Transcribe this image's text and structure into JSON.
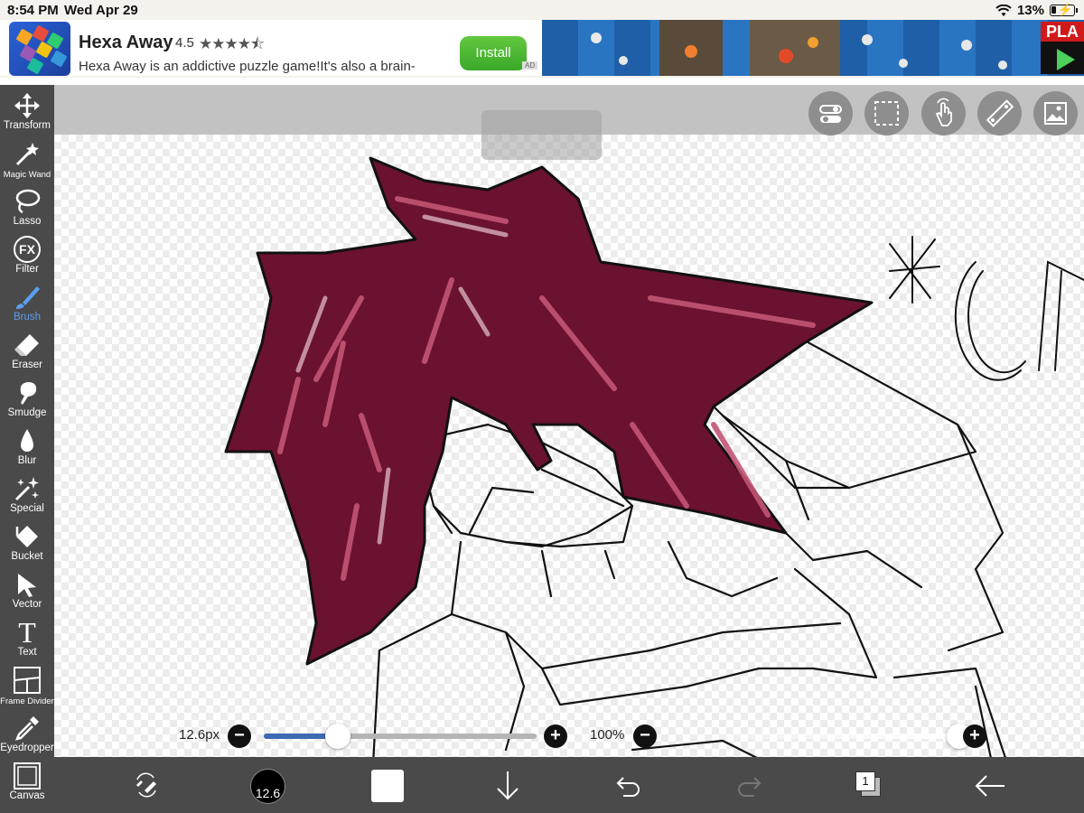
{
  "status_bar": {
    "time": "8:54 PM",
    "date": "Wed Apr 29",
    "battery": "13%"
  },
  "ad": {
    "title": "Hexa Away",
    "rating": "4.5",
    "stars": "★★★★⯪",
    "description": "Hexa Away is an addictive puzzle game!It's also a brain-",
    "install_label": "Install",
    "badge": "AD",
    "info": "i",
    "right_banner_text": "PLA"
  },
  "toolbar": {
    "items": [
      {
        "label": "Transform",
        "icon": "move-arrows-icon"
      },
      {
        "label": "Magic Wand",
        "icon": "magic-wand-icon"
      },
      {
        "label": "Lasso",
        "icon": "lasso-icon"
      },
      {
        "label": "Filter",
        "icon": "fx-icon",
        "glyph": "FX"
      },
      {
        "label": "Brush",
        "icon": "brush-icon",
        "active": true
      },
      {
        "label": "Eraser",
        "icon": "eraser-icon"
      },
      {
        "label": "Smudge",
        "icon": "smudge-icon"
      },
      {
        "label": "Blur",
        "icon": "blur-drop-icon"
      },
      {
        "label": "Special",
        "icon": "sparkle-wand-icon"
      },
      {
        "label": "Bucket",
        "icon": "bucket-icon"
      },
      {
        "label": "Vector",
        "icon": "vector-cursor-icon"
      },
      {
        "label": "Text",
        "icon": "text-icon",
        "glyph": "T"
      },
      {
        "label": "Frame Divider",
        "icon": "frame-divider-icon"
      },
      {
        "label": "Eyedropper",
        "icon": "eyedropper-icon"
      },
      {
        "label": "Canvas",
        "icon": "canvas-icon"
      }
    ]
  },
  "top_tools": [
    "toggle-icon",
    "selection-icon",
    "hand-touch-icon",
    "ruler-icon",
    "image-icon"
  ],
  "brush": {
    "size_label": "12.6px",
    "size_badge": "12.6",
    "size_fraction": 0.27,
    "opacity_label": "100%",
    "opacity_fraction": 1.0
  },
  "bottom_bar": {
    "layers_count": "1"
  },
  "drawing_text": "*CR",
  "colors": {
    "accent": "#5a9ef0",
    "hair": "#8a1f3c",
    "toolbar": "#4a4a4a",
    "slider_fill": "#3c6ab3"
  }
}
